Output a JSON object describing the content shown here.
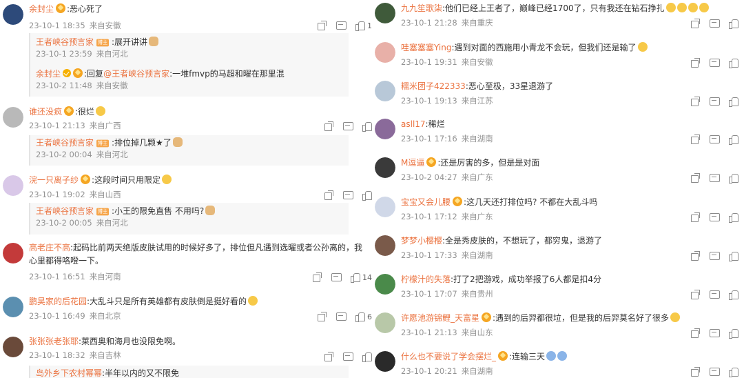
{
  "left": [
    {
      "avatar_color": "#2d4a7a",
      "user": "余封尘",
      "verified": false,
      "badge": true,
      "text": ":恶心死了",
      "time": "23-10-1 18:35",
      "location": "来自安徽",
      "likes": "1",
      "replies": [
        {
          "user": "王者峡谷预言家",
          "tag": "博主",
          "text": ":展开讲讲",
          "emoji": "cat",
          "time": "23-10-1 23:59",
          "location": "来自河北"
        },
        {
          "user": "余封尘",
          "verified": true,
          "badge": true,
          "prefix": ":回复",
          "at": "@王者峡谷预言家",
          "text": ":一堆fmvp的马超和曜在那里混",
          "time": "23-10-2 11:48",
          "location": "来自安徽"
        }
      ]
    },
    {
      "avatar_color": "#b9b9b9",
      "user": "谁还没疯",
      "badge": true,
      "text": ":很烂",
      "emoji": "yellow",
      "time": "23-10-1 21:13",
      "location": "来自广西",
      "likes": "",
      "replies": [
        {
          "user": "王者峡谷预言家",
          "tag": "博主",
          "text": ":排位掉几颗★了",
          "emoji": "cat",
          "time": "23-10-2 00:04",
          "location": "来自河北"
        }
      ]
    },
    {
      "avatar_color": "#d9c8e8",
      "user": "浣一只离子纱",
      "badge": true,
      "text": ":这段时间只用限定",
      "emoji": "yellow",
      "time": "23-10-1 19:02",
      "location": "来自山西",
      "likes": "",
      "replies": [
        {
          "user": "王者峡谷预言家",
          "tag": "博主",
          "text": ":小王的限免直售 不用吗?",
          "emoji": "cat",
          "time": "23-10-2 00:05",
          "location": "来自河北"
        }
      ]
    },
    {
      "avatar_color": "#c33a3a",
      "user": "高老庄不高",
      "text": ":起码比前两天绝版皮肤试用的时候好多了，排位但凡遇到选曜或者公孙离的，我心里都得咯噔一下。",
      "time": "23-10-1 16:51",
      "location": "来自河南",
      "likes": "14"
    },
    {
      "avatar_color": "#5b8fb0",
      "user": "鹏昊家的后花园",
      "text": ":大乱斗只是所有英雄都有皮肤倒是挺好看的",
      "emoji": "yellow",
      "time": "23-10-1 16:49",
      "location": "来自北京",
      "likes": "6"
    },
    {
      "avatar_color": "#6a4a3a",
      "user": "张张张老张耶",
      "text": ":莱西奥和海月也没限免啊。",
      "time": "23-10-1 18:32",
      "location": "来自吉林",
      "likes": "",
      "replies": [
        {
          "user": "岛外乡下农村幂幂",
          "text": ":半年以内的又不限免",
          "time": "",
          "location": ""
        }
      ]
    }
  ],
  "right": [
    {
      "avatar_color": "#3f5a3a",
      "user": "九九笙歌柒",
      "text": ":他们已经上王者了，巅峰已经1700了，只有我还在钻石挣扎",
      "emojis": 4,
      "time": "23-10-1 21:28",
      "location": "来自重庆"
    },
    {
      "avatar_color": "#e8b0a8",
      "user": "哇塞塞塞Ying",
      "text": ":遇到对面的西施用小青龙不会玩，但我们还是输了",
      "emojis": 1,
      "time": "23-10-1 19:31",
      "location": "来自安徽"
    },
    {
      "avatar_color": "#b8c8d8",
      "user": "糯米团子422333",
      "text": ":恶心至极，33星退游了",
      "time": "23-10-1 19:13",
      "location": "来自江苏"
    },
    {
      "avatar_color": "#8a6a9a",
      "user": "asll17",
      "text": ":稀烂",
      "time": "23-10-1 17:16",
      "location": "来自湖南"
    },
    {
      "avatar_color": "#3a3a3a",
      "user": "M逗逼",
      "badge": true,
      "text": ":还是厉害的多，但是是对面",
      "time": "23-10-2 04:27",
      "location": "来自广东"
    },
    {
      "avatar_color": "#d0d8e8",
      "user": "宝宝又会儿腰",
      "badge": true,
      "text": ":这几天还打排位吗? 不都在大乱斗吗",
      "time": "23-10-1 17:12",
      "location": "来自广东"
    },
    {
      "avatar_color": "#7a5a4a",
      "user": "梦梦小樱樱",
      "text": ":全是秀皮肤的，不想玩了，都穷鬼，退游了",
      "time": "23-10-1 17:33",
      "location": "来自湖南"
    },
    {
      "avatar_color": "#4a8a4a",
      "user": "柠檬汁的失落",
      "text": ":打了2把游戏，成功举报了6人都是扣4分",
      "time": "23-10-1 17:07",
      "location": "来自贵州"
    },
    {
      "avatar_color": "#b8c8a8",
      "user": "许愿池游锦鲤_天富星",
      "badge": true,
      "text": ":遇到的后羿都很垃，但是我的后羿莫名好了很多",
      "emojis": 1,
      "time": "23-10-1 21:13",
      "location": "来自山东"
    },
    {
      "avatar_color": "#2a2a2a",
      "user": "什么也不要说了学会摆烂_",
      "badge": true,
      "text": ":连输三天",
      "emojis": 2,
      "emoji_style": "blue",
      "time": "23-10-1 20:21",
      "location": "来自湖南"
    }
  ],
  "colors": {
    "username": "#eb7340",
    "meta": "#939393",
    "icon": "#8a8a8a"
  },
  "icons": [
    "share-icon",
    "comment-icon",
    "like-icon"
  ]
}
